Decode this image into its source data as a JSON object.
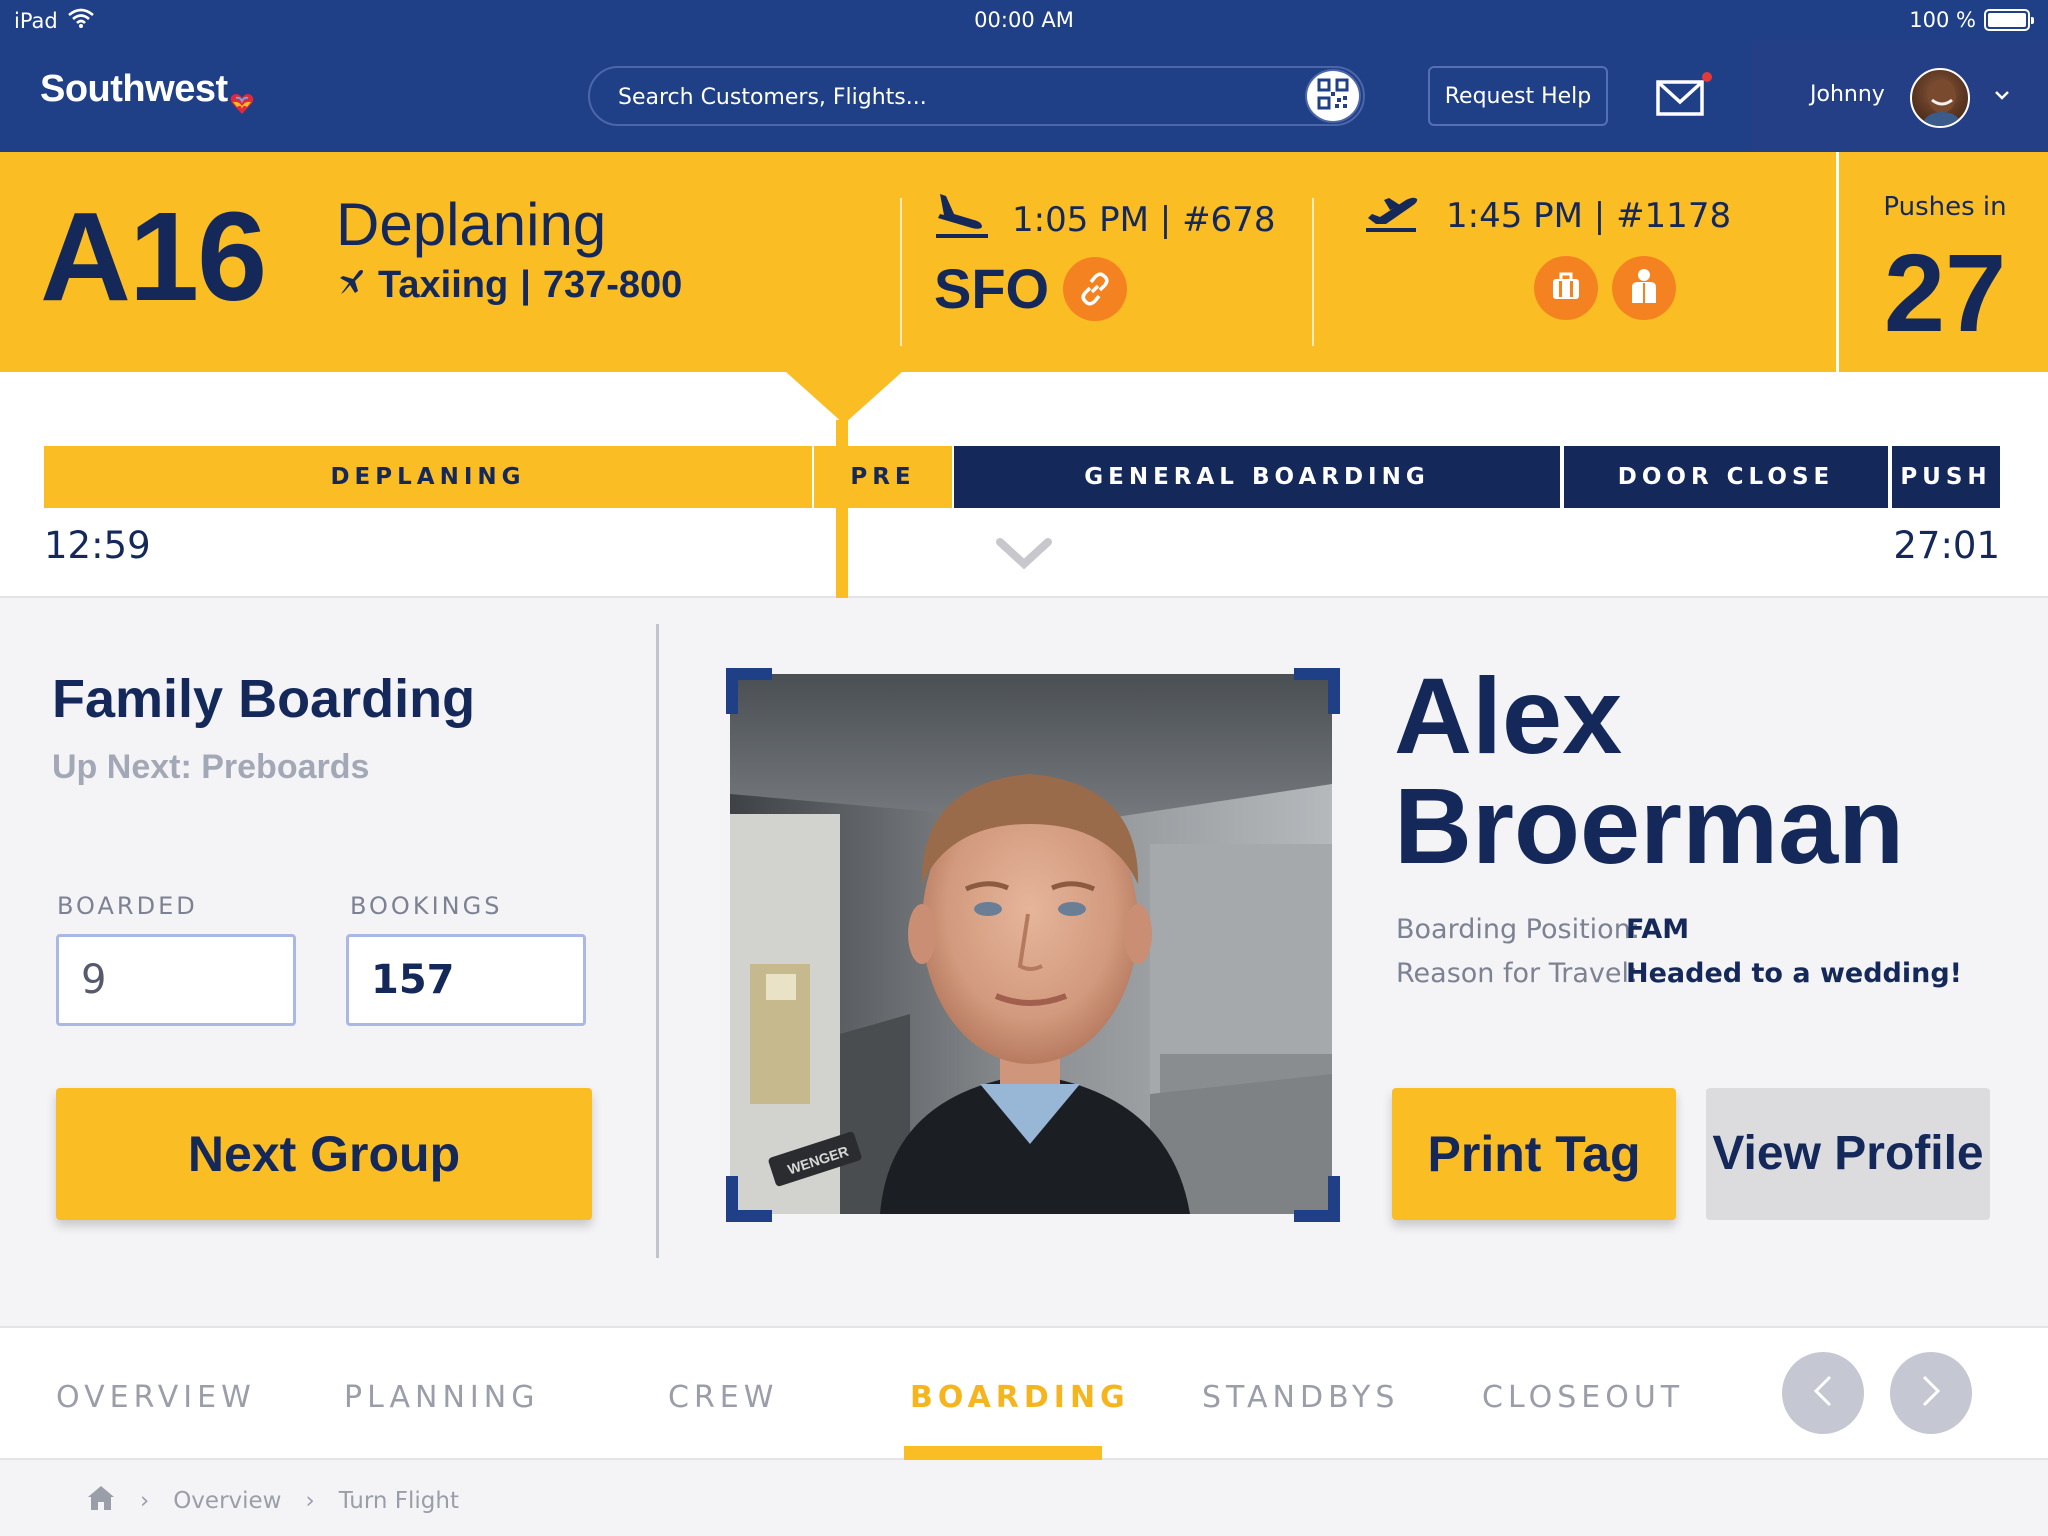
{
  "status_bar": {
    "device": "iPad",
    "time": "00:00 AM",
    "battery": "100 %",
    "battery_level": 1.0
  },
  "header": {
    "brand": "Southwest",
    "search_placeholder": "Search Customers, Flights...",
    "help_label": "Request Help",
    "user_name": "Johnny"
  },
  "flight": {
    "gate": "A16",
    "status": "Deplaning",
    "substatus": "Taxiing",
    "aircraft": "737-800",
    "arrival": {
      "time": "1:05 PM | #678",
      "airport": "SFO"
    },
    "departure": {
      "time": "1:45 PM | #1178"
    },
    "pushes_label": "Pushes in",
    "pushes_value": "27"
  },
  "timeline": {
    "segments": [
      "DEPLANING",
      "PRE",
      "GENERAL BOARDING",
      "DOOR CLOSE",
      "PUSH"
    ],
    "elapsed": "12:59",
    "remaining": "27:01"
  },
  "boarding": {
    "title": "Family Boarding",
    "subtitle": "Up Next: Preboards",
    "boarded_label": "BOARDED",
    "boarded_value": "9",
    "bookings_label": "BOOKINGS",
    "bookings_value": "157",
    "next_button": "Next Group"
  },
  "passenger": {
    "first_name": "Alex",
    "last_name": "Broerman",
    "position_label": "Boarding Position:",
    "position_value": "FAM",
    "reason_label": "Reason for Travel:",
    "reason_value": "Headed to a wedding!",
    "print_button": "Print Tag",
    "profile_button": "View Profile",
    "photo_watermark": "WENGER"
  },
  "tabs": [
    {
      "label": "OVERVIEW",
      "active": false
    },
    {
      "label": "PLANNING",
      "active": false
    },
    {
      "label": "CREW",
      "active": false
    },
    {
      "label": "BOARDING",
      "active": true
    },
    {
      "label": "STANDBYS",
      "active": false
    },
    {
      "label": "CLOSEOUT",
      "active": false
    }
  ],
  "breadcrumb": [
    "Overview",
    "Turn Flight"
  ],
  "colors": {
    "navy": "#14285a",
    "header_blue": "#1f3f87",
    "yellow": "#fbbd24",
    "orange": "#f58220",
    "gray_text": "#9a9ea9"
  },
  "icons": [
    "wifi-icon",
    "battery-icon",
    "heart-logo-icon",
    "qr-code-icon",
    "mail-icon",
    "chevron-down-icon",
    "plane-icon",
    "landing-icon",
    "takeoff-icon",
    "link-icon",
    "bag-icon",
    "attendant-icon",
    "home-icon",
    "chevron-left-icon",
    "chevron-right-icon"
  ]
}
